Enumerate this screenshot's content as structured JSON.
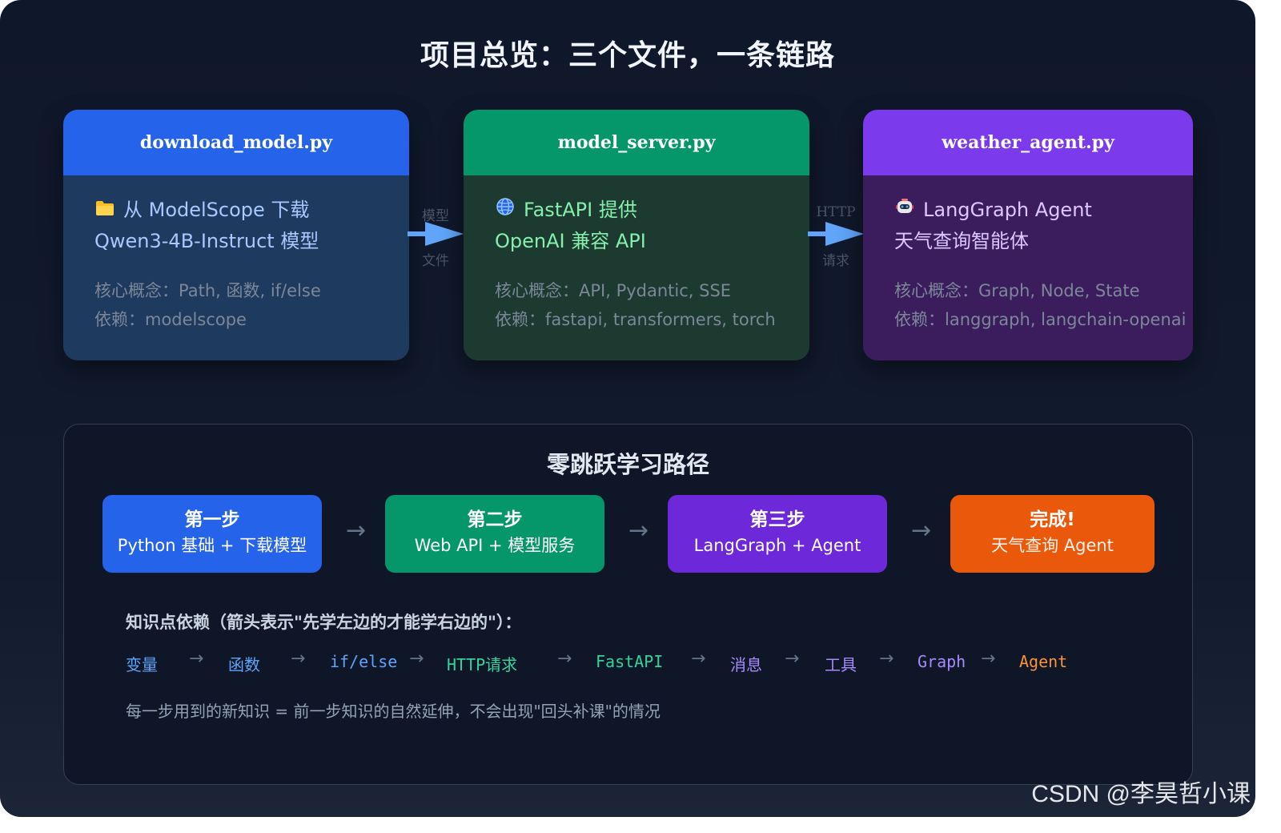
{
  "title": "项目总览：三个文件，一条链路",
  "cards": [
    {
      "filename": "download_model.py",
      "icon": "folder-icon",
      "line1": "从 ModelScope 下载",
      "line2": "Qwen3-4B-Instruct 模型",
      "concepts": "核心概念：Path, 函数, if/else",
      "deps": "依赖：modelscope",
      "header_color": "#2563eb",
      "body_color": "#1e3a5f"
    },
    {
      "filename": "model_server.py",
      "icon": "globe-icon",
      "line1": "FastAPI 提供",
      "line2": "OpenAI 兼容 API",
      "concepts": "核心概念：API, Pydantic, SSE",
      "deps": "依赖：fastapi, transformers, torch",
      "header_color": "#059669",
      "body_color": "#1c3a2f"
    },
    {
      "filename": "weather_agent.py",
      "icon": "robot-icon",
      "line1": "LangGraph Agent",
      "line2": "天气查询智能体",
      "concepts": "核心概念：Graph, Node, State",
      "deps": "依赖：langgraph, langchain-openai",
      "header_color": "#7c3aed",
      "body_color": "#3b1d5e"
    }
  ],
  "connectors": [
    {
      "top": "模型",
      "bottom": "文件"
    },
    {
      "top": "HTTP",
      "bottom": "请求"
    }
  ],
  "path": {
    "title": "零跳跃学习路径",
    "steps": [
      {
        "title": "第一步",
        "desc": "Python 基础 + 下载模型",
        "color": "#2563eb"
      },
      {
        "title": "第二步",
        "desc": "Web API + 模型服务",
        "color": "#059669"
      },
      {
        "title": "第三步",
        "desc": "LangGraph + Agent",
        "color": "#6d28d9"
      },
      {
        "title": "完成!",
        "desc": "天气查询 Agent",
        "color": "#ea580c"
      }
    ],
    "arrow": "→",
    "dep_title": "知识点依赖（箭头表示\"先学左边的才能学右边的\"）：",
    "dep_items": [
      {
        "label": "变量",
        "color": "#60a5fa"
      },
      {
        "label": "函数",
        "color": "#60a5fa"
      },
      {
        "label": "if/else",
        "color": "#60a5fa"
      },
      {
        "label": "HTTP请求",
        "color": "#34d399"
      },
      {
        "label": "FastAPI",
        "color": "#34d399"
      },
      {
        "label": "消息",
        "color": "#a78bfa"
      },
      {
        "label": "工具",
        "color": "#a78bfa"
      },
      {
        "label": "Graph",
        "color": "#a78bfa"
      },
      {
        "label": "Agent",
        "color": "#fb923c"
      }
    ],
    "note": "每一步用到的新知识 = 前一步知识的自然延伸，不会出现\"回头补课\"的情况"
  },
  "watermark": "CSDN @李昊哲小课",
  "connector_arrow_color": "#60a5fa"
}
